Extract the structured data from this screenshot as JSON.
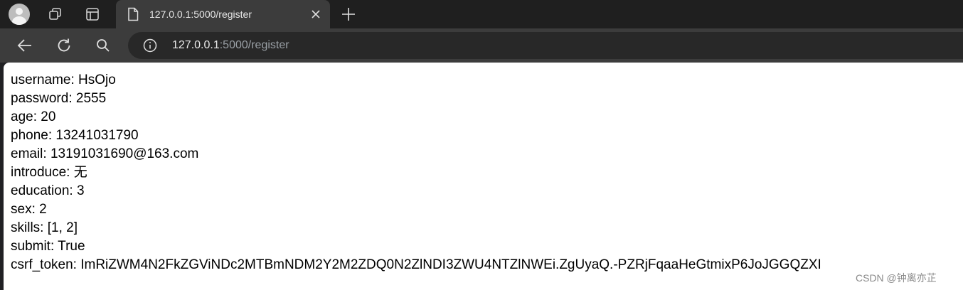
{
  "tab": {
    "title": "127.0.0.1:5000/register"
  },
  "address_bar": {
    "url_host": "127.0.0.1",
    "url_rest": ":5000/register"
  },
  "page": {
    "lines": [
      "username: HsOjo",
      "password: 2555",
      "age: 20",
      "phone: 13241031790",
      "email: 13191031690@163.com",
      "introduce: 无",
      "education: 3",
      "sex: 2",
      "skills: [1, 2]",
      "submit: True",
      "csrf_token: ImRiZWM4N2FkZGViNDc2MTBmNDM2Y2M2ZDQ0N2ZlNDI3ZWU4NTZlNWEi.ZgUyaQ.-PZRjFqaaHeGtmixP6JoJGGQZXI"
    ]
  },
  "watermark": "CSDN @钟离亦芷",
  "icons": [
    "profile-avatar-icon",
    "workspaces-icon",
    "vertical-tabs-icon",
    "file-icon",
    "close-icon",
    "plus-icon",
    "back-arrow-icon",
    "reload-icon",
    "search-icon",
    "info-icon"
  ],
  "colors": {
    "tabbar": "#1f1f1f",
    "toolbar": "#3c3c3c",
    "omnibox": "#282828",
    "content": "#ffffff",
    "url_host": "#e8e8e8",
    "url_rest": "#9aa0a6"
  }
}
